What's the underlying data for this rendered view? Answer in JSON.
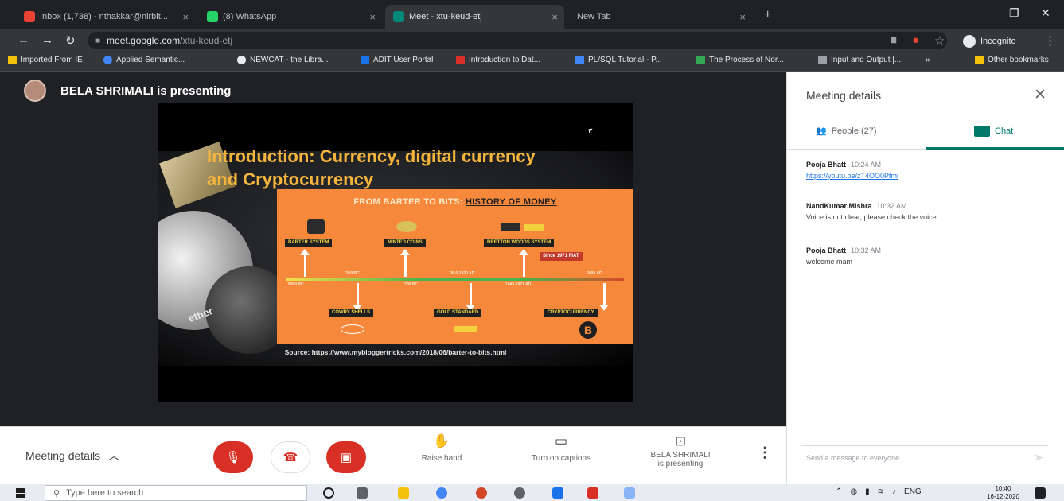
{
  "browser": {
    "tabs": [
      {
        "label": "Inbox (1,738) - nthakkar@nirbit...",
        "color": "#ea4335"
      },
      {
        "label": "(8) WhatsApp",
        "color": "#25d366"
      },
      {
        "label": "Meet - xtu-keud-etj",
        "color": "#00897b"
      },
      {
        "label": "New Tab",
        "color": "#9aa0a6"
      }
    ],
    "url_host": "meet.google.com",
    "url_path": "/xtu-keud-etj",
    "incognito_label": "Incognito",
    "bookmarks": [
      {
        "label": "Imported From IE",
        "color": "#f4c20d"
      },
      {
        "label": "Applied Semantic...",
        "color": "#4285f4"
      },
      {
        "label": "NEWCAT - the Libra...",
        "color": "#e8eaed"
      },
      {
        "label": "ADIT User Portal",
        "color": "#1a73e8"
      },
      {
        "label": "Introduction to Dat...",
        "color": "#d93025"
      },
      {
        "label": "PL/SQL Tutorial - P...",
        "color": "#4285f4"
      },
      {
        "label": "The Process of Nor...",
        "color": "#34a853"
      },
      {
        "label": "Input and Output |...",
        "color": "#9aa0a6"
      },
      {
        "label": "Other bookmarks",
        "color": "#f4c20d"
      }
    ]
  },
  "meet": {
    "presenter_banner": "BELA SHRIMALI is presenting",
    "slide": {
      "title_line1": "Introduction: Currency, digital currency",
      "title_line2": "and Cryptocurrency",
      "panel_title_a": "FROM BARTER TO BITS: ",
      "panel_title_b": "HISTORY OF MONEY",
      "top_labels": [
        "BARTER SYSTEM",
        "MINTED COINS",
        "BRETTON WOODS SYSTEM"
      ],
      "bottom_labels": [
        "COWRY SHELLS",
        "GOLD STANDARD",
        "CRYPTOCURRENCY"
      ],
      "red_label": "Since 1971 FIAT",
      "years": [
        "9000 BC",
        "1200 BC",
        "700 BC",
        "1816-1930 AD",
        "1945-1971 AD",
        "2009 AD"
      ],
      "ether_text": "ether",
      "btc_symbol": "B",
      "source": "Source: https://www.mybloggertricks.com/2018/06/barter-to-bits.html"
    },
    "bottom_bar": {
      "meeting_details": "Meeting details",
      "raise_hand": "Raise hand",
      "captions": "Turn on captions",
      "presenting_line1": "BELA SHRIMALI",
      "presenting_line2": "is presenting"
    },
    "side_panel": {
      "title": "Meeting details",
      "people_tab": "People (27)",
      "chat_tab": "Chat",
      "messages": [
        {
          "name": "Pooja Bhatt",
          "time": "10:24 AM",
          "text": "https://youtu.be/zT4OO0Ptmi",
          "is_link": true
        },
        {
          "name": "NandKumar Mishra",
          "time": "10:32 AM",
          "text": "Voice is not clear, please check the voice",
          "is_link": false
        },
        {
          "name": "Pooja Bhatt",
          "time": "10:32 AM",
          "text": "welcome mam",
          "is_link": false
        }
      ],
      "send_placeholder": "Send a message to everyone"
    }
  },
  "taskbar": {
    "search_placeholder": "Type here to search",
    "lang": "ENG",
    "time": "10:40",
    "date": "16-12-2020"
  }
}
